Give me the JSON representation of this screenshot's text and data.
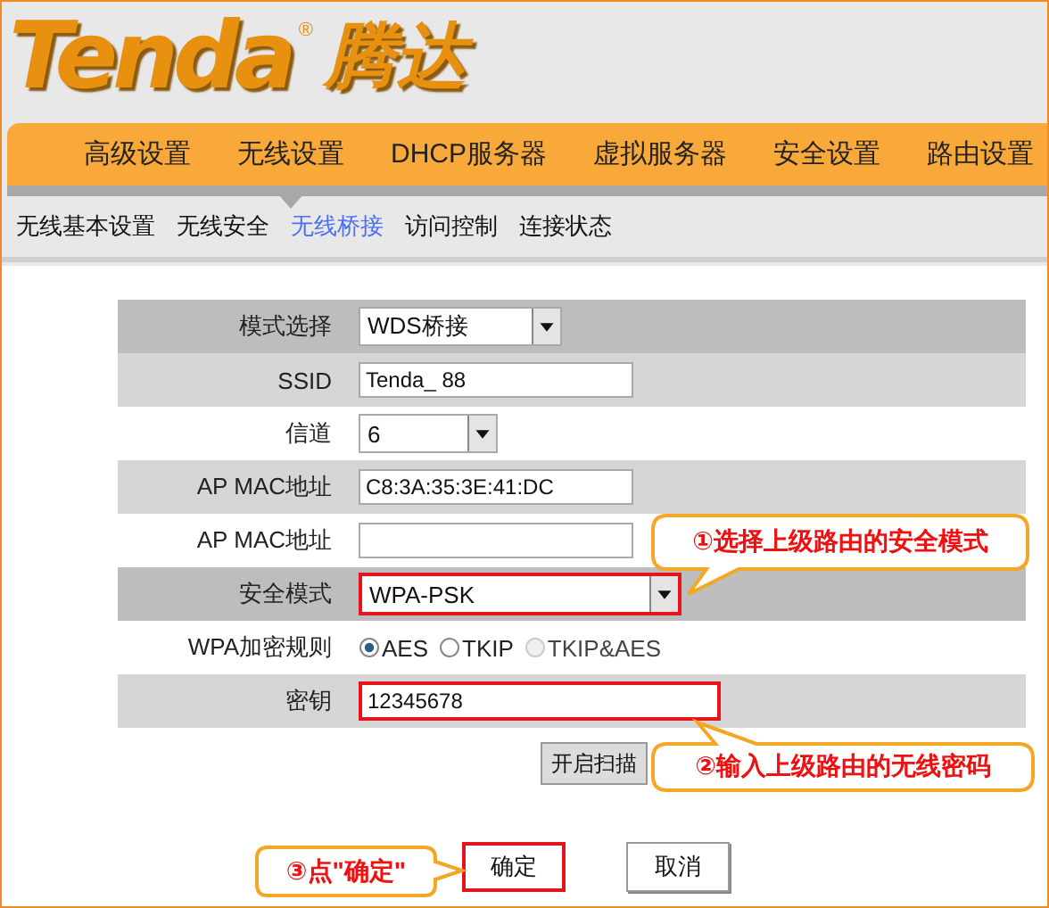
{
  "logo": {
    "brand": "Tenda",
    "registered": "®",
    "name_cn": "腾达"
  },
  "nav": [
    {
      "label": "高级设置",
      "selected": false
    },
    {
      "label": "无线设置",
      "selected": true
    },
    {
      "label": "DHCP服务器",
      "selected": false
    },
    {
      "label": "虚拟服务器",
      "selected": false
    },
    {
      "label": "安全设置",
      "selected": false
    },
    {
      "label": "路由设置",
      "selected": false
    }
  ],
  "subnav": [
    {
      "label": "无线基本设置",
      "selected": false
    },
    {
      "label": "无线安全",
      "selected": false
    },
    {
      "label": "无线桥接",
      "selected": true
    },
    {
      "label": "访问控制",
      "selected": false
    },
    {
      "label": "连接状态",
      "selected": false
    }
  ],
  "form": {
    "rows": [
      {
        "label": "模式选择",
        "kind": "select",
        "value": "WDS桥接",
        "highlighted": true
      },
      {
        "label": "SSID",
        "kind": "text",
        "value": "Tenda_ 88",
        "highlighted": false
      },
      {
        "label": "信道",
        "kind": "select",
        "value": "6",
        "highlighted": false
      },
      {
        "label": "AP MAC地址",
        "kind": "text",
        "value": "C8:3A:35:3E:41:DC",
        "highlighted": false
      },
      {
        "label": "AP MAC地址",
        "kind": "text",
        "highlighted": false
      },
      {
        "label": "安全模式",
        "kind": "select",
        "value": "WPA-PSK",
        "highlighted": true,
        "marked": true
      },
      {
        "label": "WPA加密规则",
        "kind": "radio",
        "highlighted": false,
        "options": [
          {
            "label": "AES",
            "selected": true,
            "disabled": false
          },
          {
            "label": "TKIP",
            "selected": false,
            "disabled": false
          },
          {
            "label": "TKIP&AES",
            "selected": false,
            "disabled": true
          }
        ]
      },
      {
        "label": "密钥",
        "kind": "text",
        "value": "12345678",
        "highlighted": false,
        "marked": true
      }
    ],
    "scan_button": "开启扫描",
    "buttons": [
      {
        "label": "确定",
        "marked": true
      },
      {
        "label": "取消"
      }
    ]
  },
  "annotations": [
    {
      "text": "①选择上级路由的安全模式"
    },
    {
      "text": "②输入上级路由的无线密码"
    },
    {
      "text": "③点\"确定\""
    }
  ]
}
